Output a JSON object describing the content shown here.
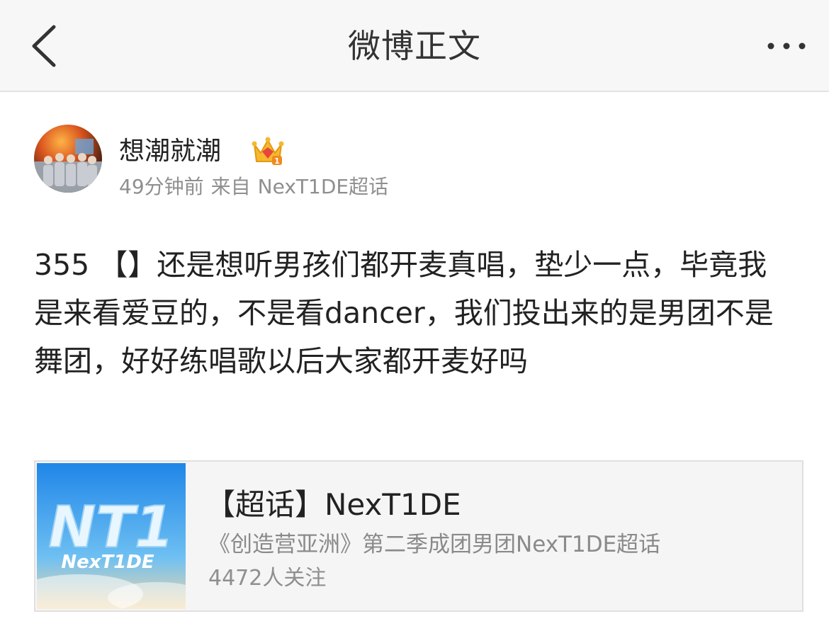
{
  "nav": {
    "title": "微博正文",
    "back_icon": "chevron-left-icon",
    "more_icon": "more-dots-icon"
  },
  "post": {
    "author": "想潮就潮",
    "badge_icon": "crown-icon",
    "time": "49分钟前",
    "source_prefix": "来自",
    "source": "NexT1DE超话",
    "content": "355 【】还是想听男孩们都开麦真唱，垫少一点，毕竟我是来看爱豆的，不是看dancer，我们投出来的是男团不是舞团，好好练唱歌以后大家都开麦好吗"
  },
  "card": {
    "title": "【超话】NexT1DE",
    "description": "《创造营亚洲》第二季成团男团NexT1DE超话",
    "followers": "4472人关注",
    "thumb_text_big": "NT1",
    "thumb_text_small": "NexT1DE"
  },
  "colors": {
    "nav_bg": "#f7f7f7",
    "text": "#222222",
    "meta": "#8f8f8f",
    "card_bg": "#f5f5f5",
    "crown_gold": "#f5b82e",
    "crown_red": "#e8463c",
    "thumb_blue": "#2f8fe6"
  }
}
